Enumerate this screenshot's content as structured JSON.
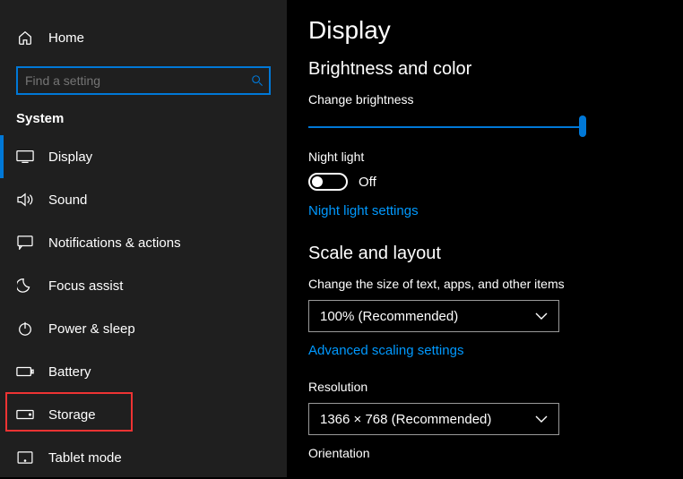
{
  "sidebar": {
    "home_label": "Home",
    "search_placeholder": "Find a setting",
    "section_label": "System",
    "items": [
      {
        "label": "Display",
        "icon": "monitor",
        "active": true
      },
      {
        "label": "Sound",
        "icon": "sound"
      },
      {
        "label": "Notifications & actions",
        "icon": "notifications"
      },
      {
        "label": "Focus assist",
        "icon": "moon"
      },
      {
        "label": "Power & sleep",
        "icon": "power"
      },
      {
        "label": "Battery",
        "icon": "battery"
      },
      {
        "label": "Storage",
        "icon": "drive",
        "highlighted": true
      },
      {
        "label": "Tablet mode",
        "icon": "tablet"
      }
    ]
  },
  "main": {
    "title": "Display",
    "section_brightness": "Brightness and color",
    "brightness_label": "Change brightness",
    "brightness_value": 100,
    "nightlight_label": "Night light",
    "nightlight_state": "Off",
    "nightlight_link": "Night light settings",
    "section_scale": "Scale and layout",
    "scale_label": "Change the size of text, apps, and other items",
    "scale_value": "100% (Recommended)",
    "scaling_link": "Advanced scaling settings",
    "resolution_label": "Resolution",
    "resolution_value": "1366 × 768 (Recommended)",
    "orientation_label": "Orientation"
  }
}
